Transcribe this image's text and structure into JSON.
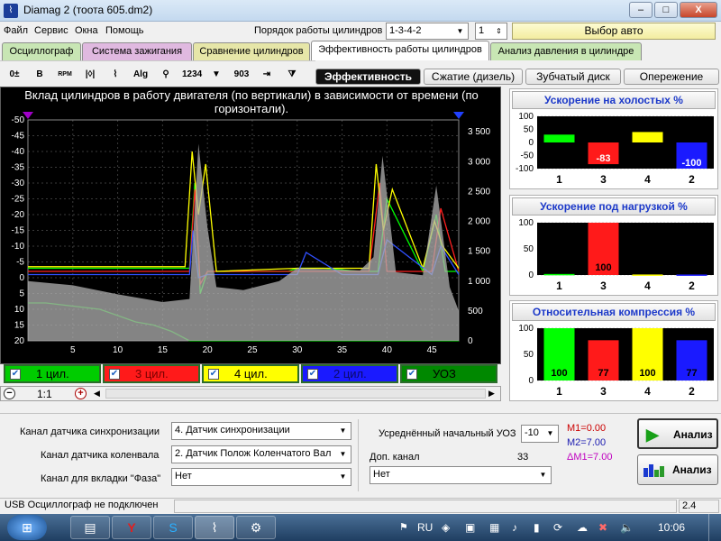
{
  "window": {
    "title": "Diamag 2 (тоота 605.dm2)",
    "min": "–",
    "max": "□",
    "close": "X"
  },
  "menu": [
    "Файл",
    "Сервис",
    "Окна",
    "Помощь"
  ],
  "cyl_order": {
    "label": "Порядок работы цилиндров",
    "value": "1-3-4-2",
    "num": "1",
    "car_button": "Выбор авто"
  },
  "main_tabs": [
    {
      "label": "Осциллограф",
      "color": "#c8e6b4"
    },
    {
      "label": "Система зажигания",
      "color": "#e0b9e0"
    },
    {
      "label": "Сравнение цилиндров",
      "color": "#e6e6a8"
    },
    {
      "label": "Эффективность работы цилиндров",
      "color": "#ffffff"
    },
    {
      "label": "Анализ давления в цилиндре",
      "color": "#c8e6b4"
    }
  ],
  "toolbar_icons": [
    {
      "name": "offset-icon",
      "glyph": "0±"
    },
    {
      "name": "bold-icon",
      "glyph": "B"
    },
    {
      "name": "rpm-icon",
      "glyph": "RPM"
    },
    {
      "name": "scale-icon",
      "glyph": "|◊|"
    },
    {
      "name": "trend-icon",
      "glyph": "⌇"
    },
    {
      "name": "algorithm-icon",
      "glyph": "Alg"
    },
    {
      "name": "sync-icon",
      "glyph": "⚲"
    },
    {
      "name": "order-icon",
      "glyph": "1234"
    },
    {
      "name": "filter-icon",
      "glyph": "▼"
    },
    {
      "name": "angle-icon",
      "glyph": "903"
    },
    {
      "name": "export-icon",
      "glyph": "⇥"
    },
    {
      "name": "funnel-icon",
      "glyph": "⧩"
    }
  ],
  "sub_tabs": [
    "Эффективность",
    "Сжатие (дизель)",
    "Зубчатый диск",
    "Опережение"
  ],
  "chart": {
    "title": "Вклад цилиндров в работу двигателя (по вертикали) в зависимости от времени (по горизонтали).",
    "left_ticks": [
      "-50",
      "-45",
      "-40",
      "-35",
      "-30",
      "-25",
      "-20",
      "-15",
      "-10",
      "-5",
      "0",
      "5",
      "10",
      "15",
      "20"
    ],
    "right_ticks": [
      "3 500",
      "3 000",
      "2 500",
      "2 000",
      "1 500",
      "1 000",
      "500",
      "0"
    ],
    "x_ticks": [
      "5",
      "10",
      "15",
      "20",
      "25",
      "30",
      "35",
      "40",
      "45"
    ]
  },
  "chart_data": {
    "type": "line",
    "title": "Вклад цилиндров в работу двигателя (по вертикали) в зависимости от времени (по горизонтали).",
    "xlim": [
      0,
      48
    ],
    "ylim_left": [
      -50,
      20
    ],
    "ylim_right": [
      0,
      3700
    ],
    "x_ticks": [
      5,
      10,
      15,
      20,
      25,
      30,
      35,
      40,
      45
    ],
    "series": [
      {
        "name": "1 цил.",
        "color": "#00ff00",
        "x": [
          0,
          5,
          10,
          15,
          18,
          18.6,
          19.2,
          20,
          22,
          25,
          29,
          30,
          33,
          37,
          39,
          40,
          44,
          45.5,
          46.5,
          48
        ],
        "y": [
          -3,
          -3,
          -3,
          -3,
          -3,
          -30,
          5,
          -2,
          -2,
          -2,
          -2,
          -3,
          -3,
          -2,
          -2,
          -25,
          -2,
          -20,
          -2,
          -2
        ]
      },
      {
        "name": "3 цил.",
        "color": "#ff2020",
        "x": [
          0,
          10,
          18,
          18.6,
          19.2,
          20,
          30,
          38,
          39.2,
          40,
          45,
          46,
          48
        ],
        "y": [
          -2,
          -2,
          -2,
          -28,
          2,
          -2,
          -2,
          -2,
          -30,
          -2,
          -2,
          -22,
          -2
        ]
      },
      {
        "name": "4 цил.",
        "color": "#ffff00",
        "x": [
          0,
          10,
          17.5,
          18.3,
          19,
          19.8,
          21,
          30,
          38,
          38.8,
          39.6,
          40.6,
          44,
          45.3,
          46.2,
          48
        ],
        "y": [
          -3.5,
          -3.5,
          -3.5,
          -40,
          -20,
          -36,
          -2,
          -3,
          -3,
          -36,
          -15,
          -28,
          -3,
          -18,
          -10,
          -3
        ]
      },
      {
        "name": "2 цил.",
        "color": "#3050ff",
        "x": [
          0,
          10,
          18,
          18.4,
          19,
          20,
          30,
          31,
          35,
          39,
          40,
          45,
          46,
          48
        ],
        "y": [
          -1,
          -1,
          -1,
          -15,
          0,
          -1,
          -1,
          -8,
          -1,
          -1,
          -12,
          -1,
          -10,
          -1
        ]
      },
      {
        "name": "УОЗ",
        "color": "#00c800",
        "x": [
          0,
          2,
          8,
          12,
          14,
          16,
          18,
          48
        ],
        "y": [
          8,
          8,
          10,
          14,
          15,
          17,
          20,
          20
        ]
      },
      {
        "name": "RPM",
        "color": "#b0b0b0",
        "axis": "right",
        "x": [
          0,
          5,
          10,
          15,
          18,
          19,
          20,
          21,
          24,
          28,
          30,
          33,
          37,
          38.5,
          39.5,
          41,
          44,
          45.5,
          47,
          48
        ],
        "y": [
          1000,
          930,
          780,
          650,
          700,
          3300,
          1900,
          900,
          850,
          1000,
          1220,
          1200,
          1180,
          1400,
          3100,
          1150,
          1100,
          2600,
          900,
          500
        ]
      }
    ]
  },
  "channels": [
    {
      "label": "1 цил.",
      "bg": "#00cc00",
      "text": "#000000"
    },
    {
      "label": "3 цил.",
      "bg": "#ff1a1a",
      "text": "#7a0000"
    },
    {
      "label": "4 цил.",
      "bg": "#ffff00",
      "text": "#000000"
    },
    {
      "label": "2 цил.",
      "bg": "#1a1aff",
      "text": "#0a0a6a"
    },
    {
      "label": "УОЗ",
      "bg": "#008800",
      "text": "#000000"
    }
  ],
  "zoom": {
    "value": "1:1",
    "minus": "−",
    "plus": "+"
  },
  "panels": {
    "idle": {
      "title": "Ускорение на холостых %",
      "ticks": [
        "100",
        "50",
        "0",
        "-50",
        "-100"
      ],
      "ylim": [
        -100,
        100
      ],
      "bars": [
        {
          "cyl": "1",
          "value": 30,
          "color": "#00ff00",
          "label": ""
        },
        {
          "cyl": "3",
          "value": -83,
          "color": "#ff1a1a",
          "label": "-83"
        },
        {
          "cyl": "4",
          "value": 40,
          "color": "#ffff00",
          "label": ""
        },
        {
          "cyl": "2",
          "value": -100,
          "color": "#1a1aff",
          "label": "-100"
        }
      ]
    },
    "load": {
      "title": "Ускорение под нагрузкой %",
      "ticks": [
        "100",
        "50",
        "0"
      ],
      "ylim": [
        0,
        100
      ],
      "bars": [
        {
          "cyl": "1",
          "value": 2,
          "color": "#00ff00",
          "label": ""
        },
        {
          "cyl": "3",
          "value": 100,
          "color": "#ff1a1a",
          "label": "100"
        },
        {
          "cyl": "4",
          "value": 1,
          "color": "#ffff00",
          "label": ""
        },
        {
          "cyl": "2",
          "value": 1,
          "color": "#1a1aff",
          "label": ""
        }
      ]
    },
    "compression": {
      "title": "Относительная компрессия %",
      "ticks": [
        "100",
        "50",
        "0"
      ],
      "ylim": [
        0,
        100
      ],
      "bars": [
        {
          "cyl": "1",
          "value": 100,
          "color": "#00ff00",
          "label": "100"
        },
        {
          "cyl": "3",
          "value": 77,
          "color": "#ff1a1a",
          "label": "77"
        },
        {
          "cyl": "4",
          "value": 100,
          "color": "#ffff00",
          "label": "100"
        },
        {
          "cyl": "2",
          "value": 77,
          "color": "#1a1aff",
          "label": "77"
        }
      ]
    }
  },
  "bottom": {
    "sync_label": "Канал датчика синхронизации",
    "sync_value": "4.  Датчик синхронизации",
    "crank_label": "Канал датчика коленвала",
    "crank_value": "2.  Датчик Полож Коленчатого Вал",
    "phase_label": "Канал для вкладки \"Фаза\"",
    "phase_value": "Нет",
    "uoz_label": "Усреднённый начальный УОЗ",
    "uoz_value": "-10",
    "aux_label": "Доп. канал",
    "aux_num": "33",
    "aux_value": "Нет",
    "m1": "M1=0.00",
    "m2": "M2=7.00",
    "dm1": "ΔM1=7.00",
    "analyze1": "Анализ",
    "analyze2": "Анализ"
  },
  "status": {
    "left": "USB Осциллограф не подключен",
    "right": "2.4"
  },
  "taskbar": {
    "lang": "RU",
    "time": "10:06"
  }
}
